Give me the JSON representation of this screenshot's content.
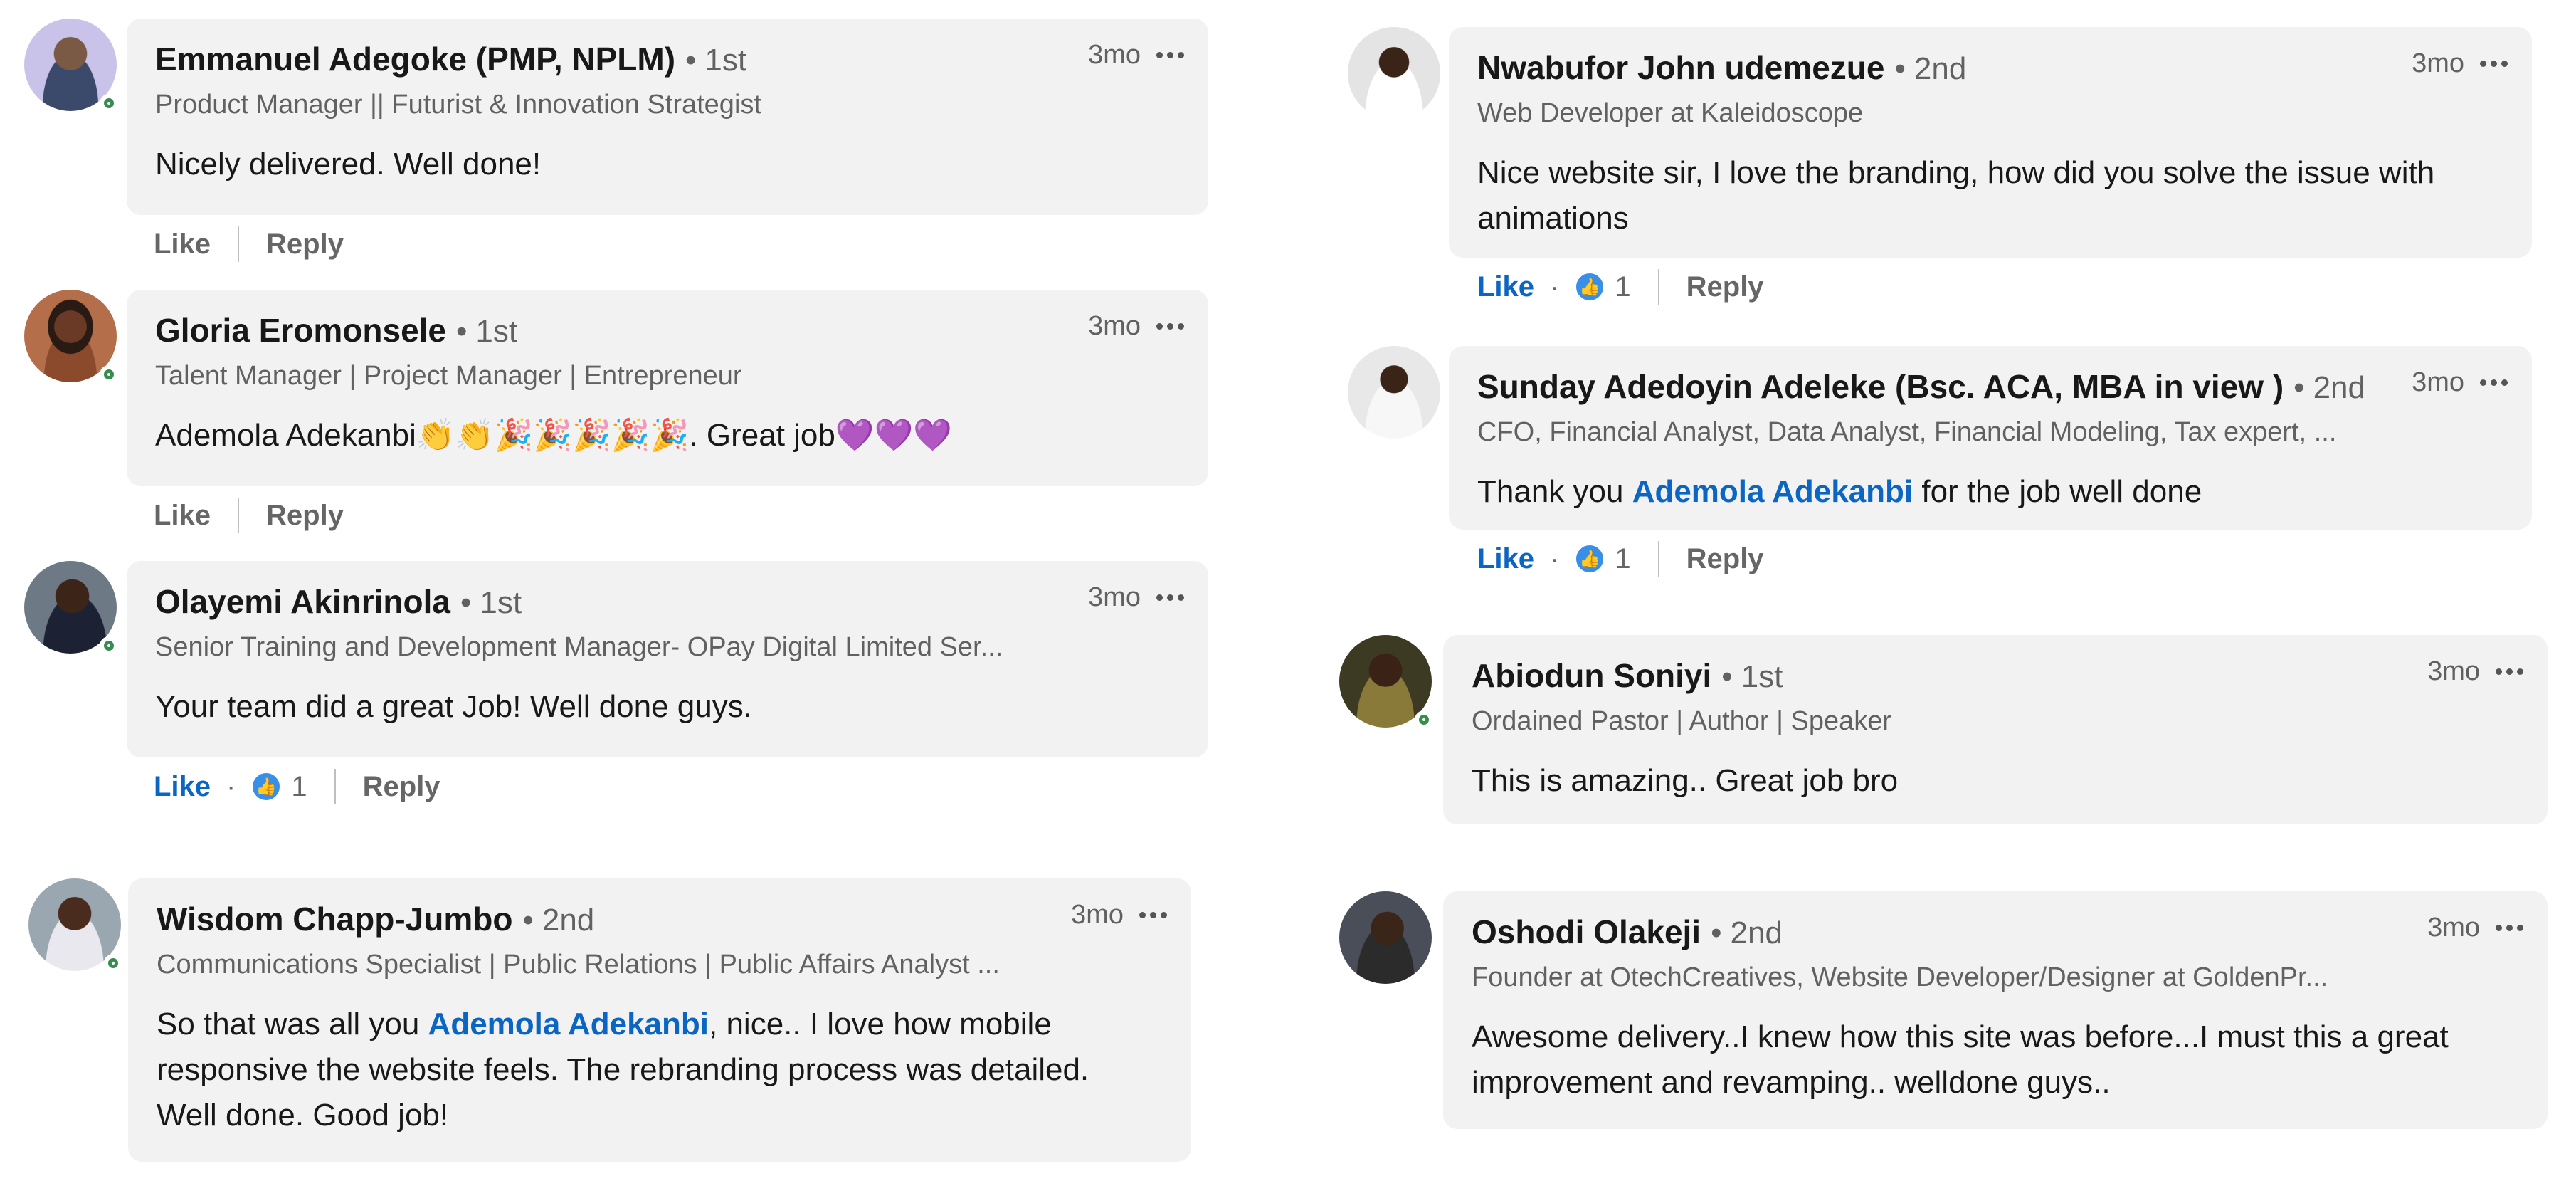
{
  "ui": {
    "like_label": "Like",
    "reply_label": "Reply",
    "more_icon": "ellipsis-icon",
    "reaction_icon": "like-reaction-icon",
    "colors": {
      "link": "#0a66c2",
      "presence": "#378d4e",
      "bubble": "#f2f2f2"
    }
  },
  "comments": [
    {
      "author": "Emmanuel Adegoke (PMP, NPLM)",
      "degree": "1st",
      "headline": "Product Manager || Futurist & Innovation Strategist",
      "time": "3mo",
      "text_parts": [
        "Nicely delivered. Well done!"
      ],
      "reactions": ""
    },
    {
      "author": "Gloria Eromonsele",
      "degree": "1st",
      "headline": "Talent Manager | Project Manager | Entrepreneur",
      "time": "3mo",
      "text_parts": [
        "Ademola Adekanbi👏👏🎉🎉🎉🎉🎉. Great job💜💜💜"
      ],
      "reactions": ""
    },
    {
      "author": "Olayemi Akinrinola",
      "degree": "1st",
      "headline": "Senior Training and Development Manager- OPay Digital Limited Ser...",
      "time": "3mo",
      "text_parts": [
        "Your team did a great Job! Well done guys."
      ],
      "reactions": "1"
    },
    {
      "author": "Wisdom Chapp-Jumbo",
      "degree": "2nd",
      "headline": "Communications Specialist | Public Relations | Public Affairs Analyst ...",
      "time": "3mo",
      "text_parts": [
        "So that was all you ",
        "Ademola Adekanbi",
        ", nice.. I love how mobile responsive the website feels. The rebranding process was detailed. Well done. Good job!"
      ],
      "reactions": ""
    },
    {
      "author": "Nwabufor John udemezue",
      "degree": "2nd",
      "headline": "Web Developer at Kaleidoscope",
      "time": "3mo",
      "text_parts": [
        "Nice website sir, I love the branding, how did you solve the issue with animations"
      ],
      "reactions": "1"
    },
    {
      "author": "Sunday Adedoyin Adeleke (Bsc. ACA, MBA in view )",
      "degree": "2nd",
      "headline": "CFO, Financial Analyst, Data Analyst, Financial Modeling, Tax expert, ...",
      "time": "3mo",
      "text_parts": [
        "Thank you ",
        "Ademola Adekanbi",
        " for the job well done"
      ],
      "reactions": "1"
    },
    {
      "author": "Abiodun Soniyi",
      "degree": "1st",
      "headline": "Ordained Pastor | Author | Speaker",
      "time": "3mo",
      "text_parts": [
        "This is amazing.. Great job bro"
      ],
      "reactions": ""
    },
    {
      "author": "Oshodi Olakeji",
      "degree": "2nd",
      "headline": "Founder at OtechCreatives, Website Developer/Designer at GoldenPr...",
      "time": "3mo",
      "text_parts": [
        "Awesome delivery..I knew how this site was before...I must this a great improvement and revamping.. welldone guys.."
      ],
      "reactions": ""
    }
  ]
}
